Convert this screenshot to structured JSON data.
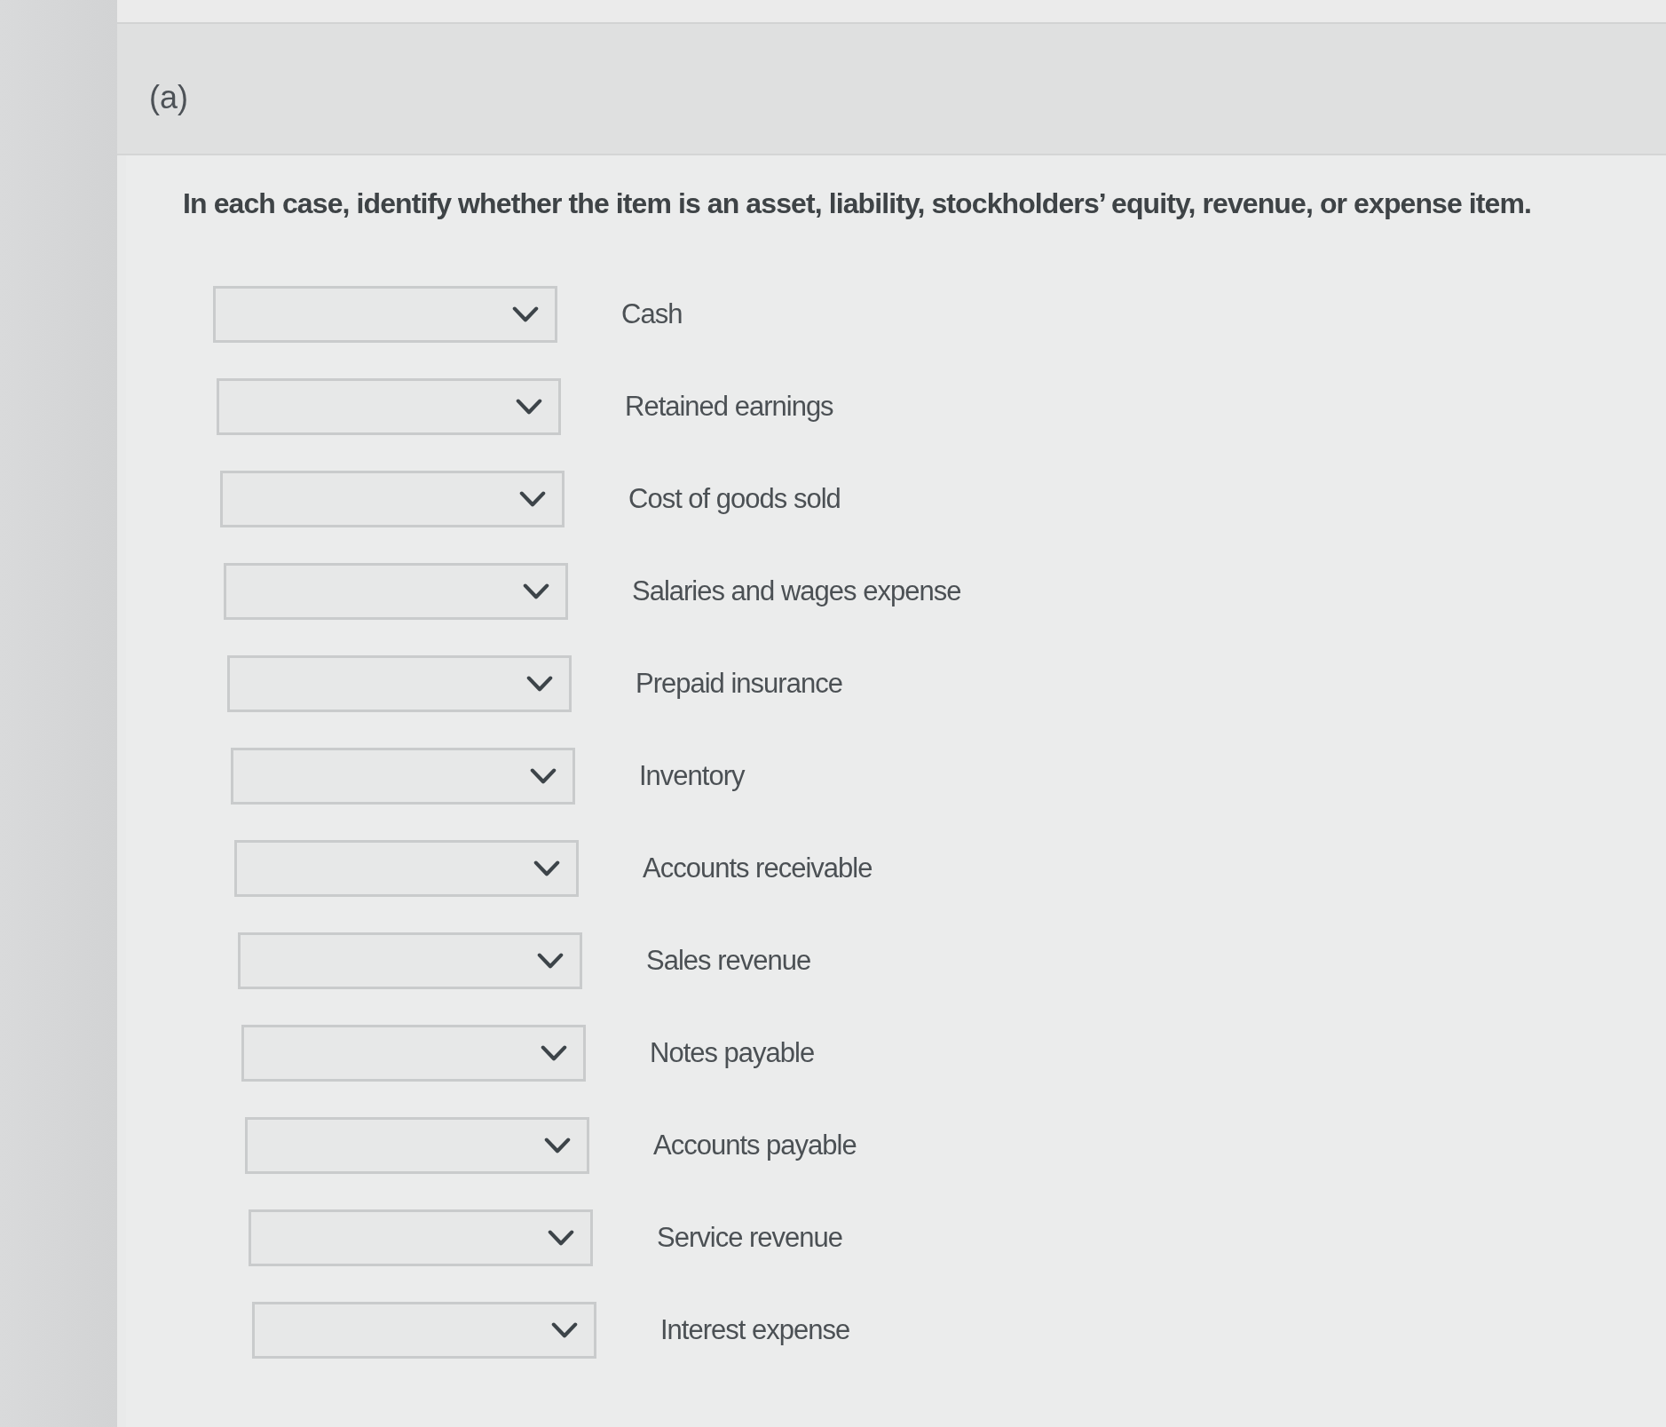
{
  "part": {
    "label": "(a)"
  },
  "instruction": "In each case, identify whether the item is an asset, liability, stockholders’ equity, revenue, or expense item.",
  "items": [
    {
      "label": "Cash"
    },
    {
      "label": "Retained earnings"
    },
    {
      "label": "Cost of goods sold"
    },
    {
      "label": "Salaries and wages expense"
    },
    {
      "label": "Prepaid insurance"
    },
    {
      "label": "Inventory"
    },
    {
      "label": "Accounts receivable"
    },
    {
      "label": "Sales revenue"
    },
    {
      "label": "Notes payable"
    },
    {
      "label": "Accounts payable"
    },
    {
      "label": "Service revenue"
    },
    {
      "label": "Interest expense"
    }
  ]
}
